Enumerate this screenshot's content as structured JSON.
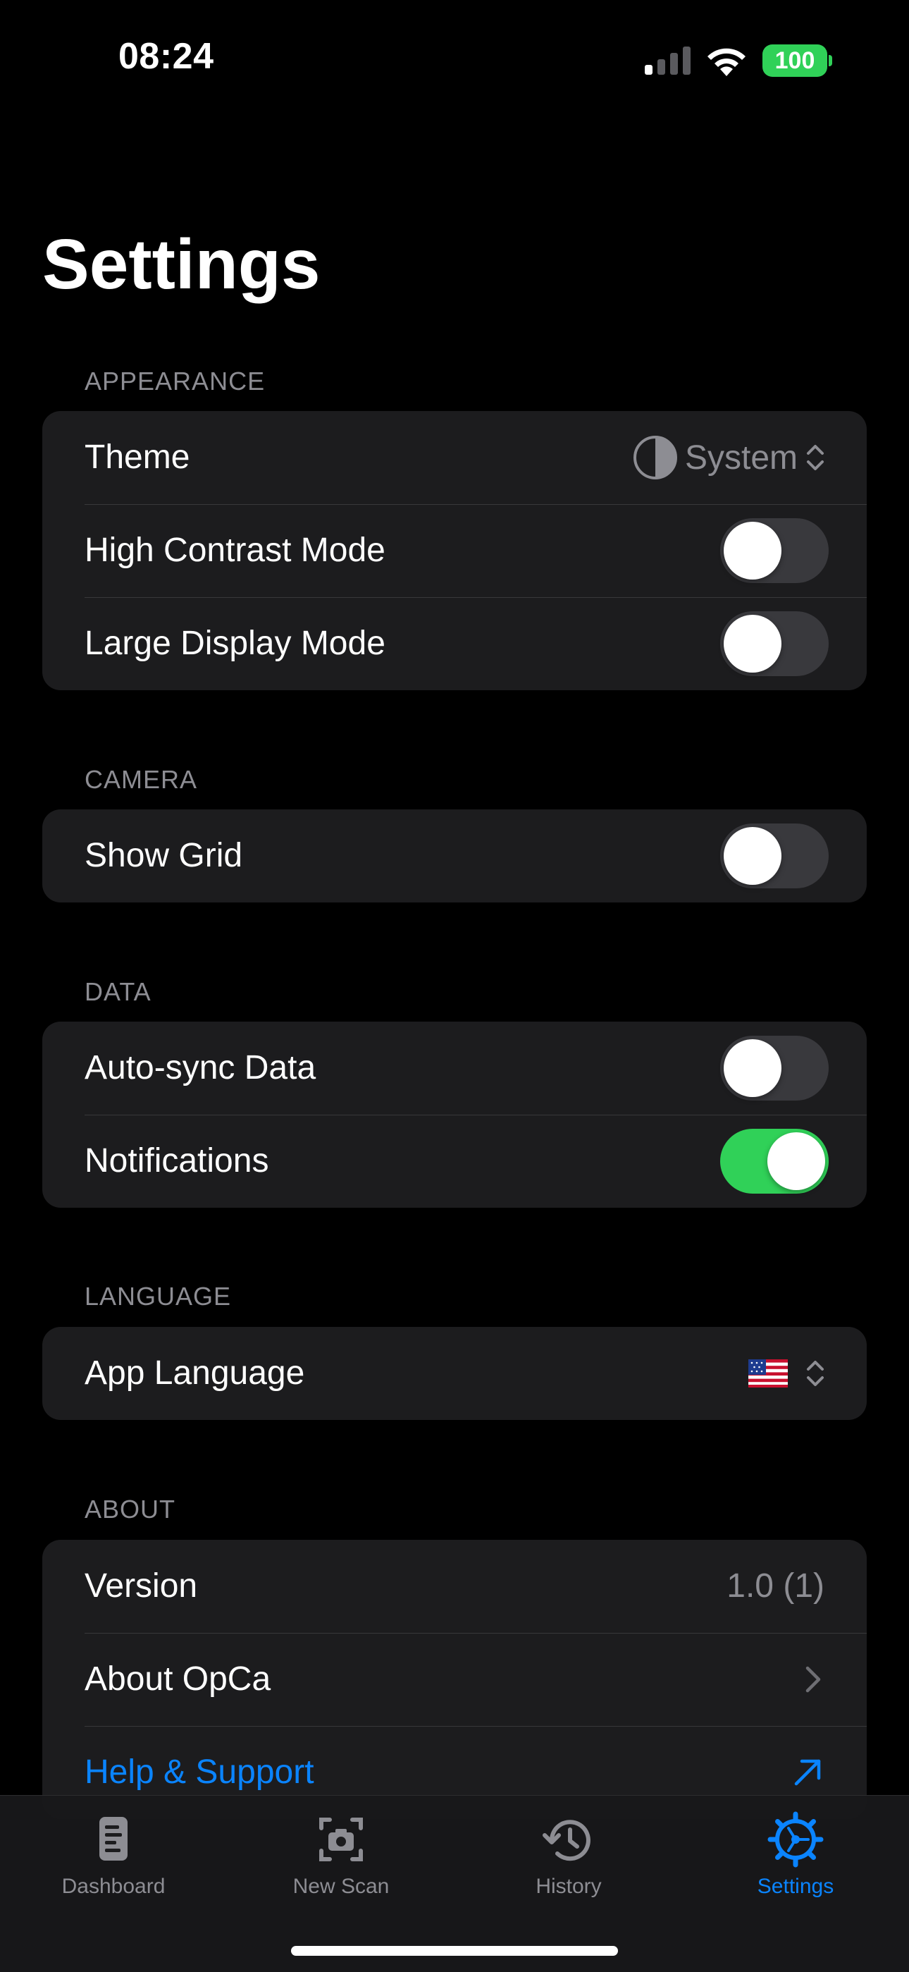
{
  "status_bar": {
    "time": "08:24",
    "battery": "100"
  },
  "page": {
    "title": "Settings"
  },
  "sections": {
    "appearance": {
      "header": "APPEARANCE",
      "theme_label": "Theme",
      "theme_value": "System",
      "high_contrast_label": "High Contrast Mode",
      "high_contrast_on": false,
      "large_display_label": "Large Display Mode",
      "large_display_on": false
    },
    "camera": {
      "header": "CAMERA",
      "show_grid_label": "Show Grid",
      "show_grid_on": false
    },
    "data": {
      "header": "DATA",
      "auto_sync_label": "Auto-sync Data",
      "auto_sync_on": false,
      "notifications_label": "Notifications",
      "notifications_on": true
    },
    "language": {
      "header": "LANGUAGE",
      "app_language_label": "App Language",
      "app_language_icon": "us-flag-icon"
    },
    "about": {
      "header": "ABOUT",
      "version_label": "Version",
      "version_value": "1.0 (1)",
      "about_label": "About OpCa",
      "help_label": "Help & Support"
    }
  },
  "tab_bar": {
    "tabs": [
      {
        "label": "Dashboard",
        "icon": "dashboard-icon",
        "active": false
      },
      {
        "label": "New Scan",
        "icon": "camera-scan-icon",
        "active": false
      },
      {
        "label": "History",
        "icon": "history-icon",
        "active": false
      },
      {
        "label": "Settings",
        "icon": "gear-icon",
        "active": true
      }
    ]
  },
  "colors": {
    "background": "#000000",
    "group_background": "#1c1c1e",
    "accent": "#0a84ff",
    "toggle_on": "#30d158",
    "toggle_off": "#39393d",
    "secondary_text": "#8d8d93"
  }
}
